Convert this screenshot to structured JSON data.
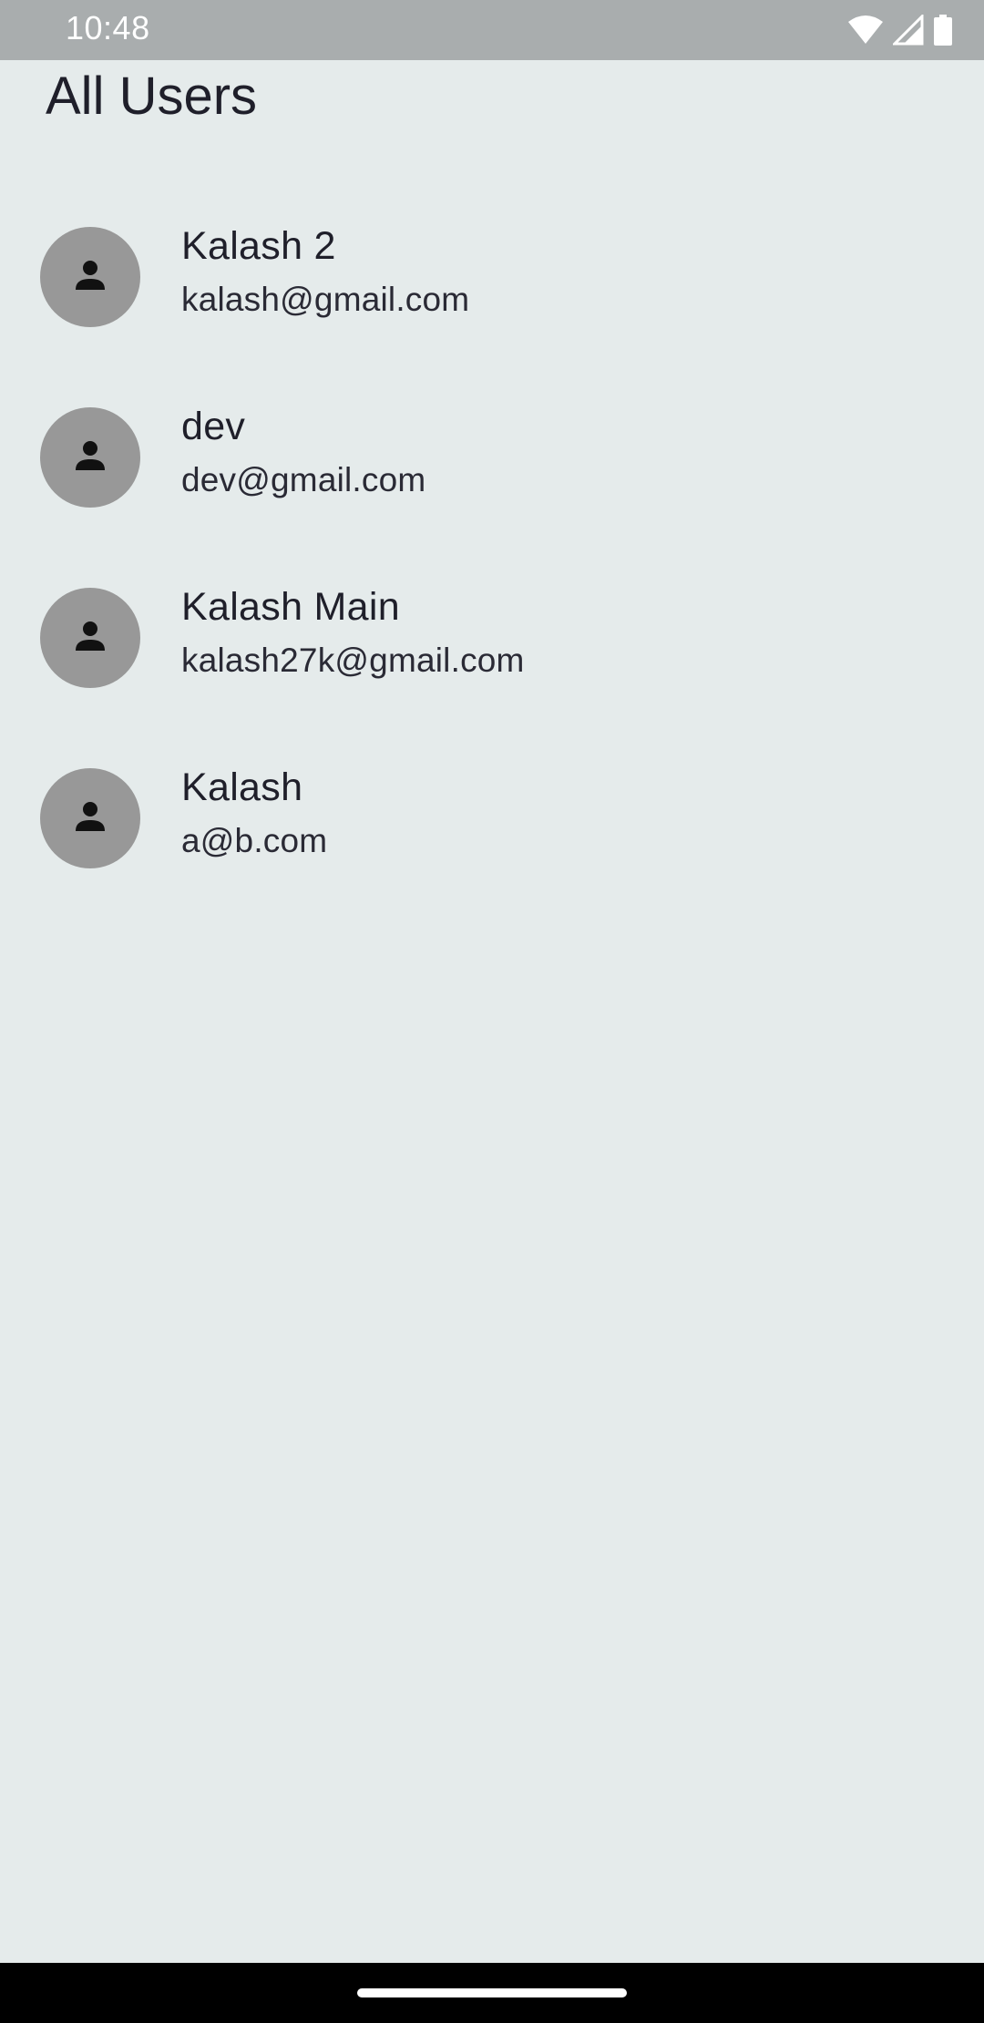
{
  "status_bar": {
    "time": "10:48",
    "icons": [
      "wifi-icon",
      "cell-signal-icon",
      "battery-icon"
    ]
  },
  "page": {
    "title": "All Users"
  },
  "users": [
    {
      "name": "Kalash 2",
      "email": "kalash@gmail.com",
      "icon": "person-icon"
    },
    {
      "name": "dev",
      "email": "dev@gmail.com",
      "icon": "person-icon"
    },
    {
      "name": "Kalash Main",
      "email": "kalash27k@gmail.com",
      "icon": "person-icon"
    },
    {
      "name": "Kalash",
      "email": "a@b.com",
      "icon": "person-icon"
    }
  ],
  "colors": {
    "background": "#e5ebeb",
    "status_bar": "#a9adae",
    "avatar": "#989898",
    "text": "#1f1f2a"
  }
}
